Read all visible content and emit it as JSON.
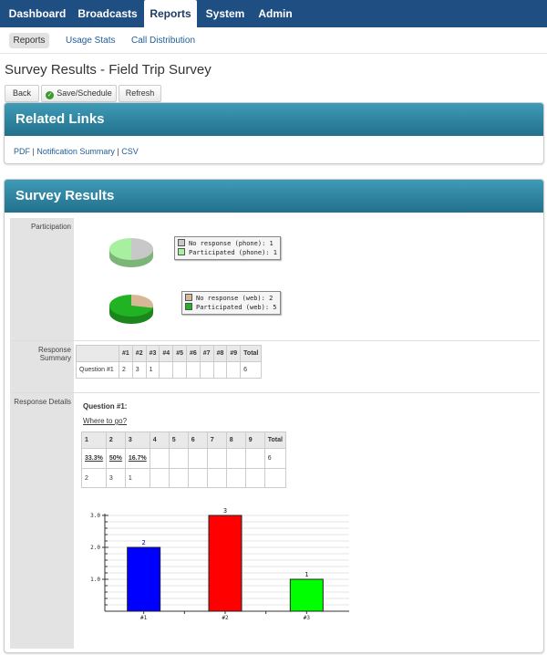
{
  "topnav": {
    "items": [
      "Dashboard",
      "Broadcasts",
      "Reports",
      "System",
      "Admin"
    ],
    "active": "Reports"
  },
  "subnav": {
    "items": [
      "Reports",
      "Usage Stats",
      "Call Distribution"
    ],
    "active": "Reports"
  },
  "page_title": "Survey Results - Field Trip Survey",
  "buttons": {
    "back": "Back",
    "save": "Save/Schedule",
    "refresh": "Refresh"
  },
  "related_links": {
    "title": "Related Links",
    "links": [
      "PDF",
      "Notification Summary",
      "CSV"
    ],
    "separator": "|"
  },
  "survey_results": {
    "title": "Survey Results",
    "labels": {
      "participation": "Participation",
      "response_summary": "Response Summary",
      "response_details": "Response Details"
    },
    "participation": {
      "phone": {
        "no_response": "No response (phone): 1",
        "participated": "Participated (phone): 1",
        "values": [
          1,
          1
        ]
      },
      "web": {
        "no_response": "No response (web): 2",
        "participated": "Participated (web): 5",
        "values": [
          2,
          5
        ]
      },
      "colors": {
        "no_response_phone": "#c8c8c8",
        "no_response_web": "#d7b896",
        "participated_phone": "#a6f0a0",
        "participated_web": "#22b324"
      }
    },
    "summary_table": {
      "headers": [
        "",
        "#1",
        "#2",
        "#3",
        "#4",
        "#5",
        "#6",
        "#7",
        "#8",
        "#9",
        "Total"
      ],
      "rows": [
        [
          "Question #1",
          "2",
          "3",
          "1",
          "",
          "",
          "",
          "",
          "",
          "",
          "6"
        ]
      ]
    },
    "details": {
      "question_label": "Question #1:",
      "question_text": "Where to go?",
      "table_headers": [
        "1",
        "2",
        "3",
        "4",
        "5",
        "6",
        "7",
        "8",
        "9",
        "Total"
      ],
      "percent_row": [
        "33.3%",
        "50%",
        "16.7%",
        "",
        "",
        "",
        "",
        "",
        "",
        "6"
      ],
      "count_row": [
        "2",
        "3",
        "1",
        "",
        "",
        "",
        "",
        "",
        "",
        ""
      ]
    }
  },
  "chart_data": {
    "type": "bar",
    "categories": [
      "#1",
      "#2",
      "#3"
    ],
    "values": [
      2,
      3,
      1
    ],
    "colors": [
      "#0000ff",
      "#ff0000",
      "#00ff00"
    ],
    "yticks": [
      "1.0",
      "2.0",
      "3.0"
    ],
    "ylim": [
      0,
      3.0
    ],
    "grid": true
  }
}
